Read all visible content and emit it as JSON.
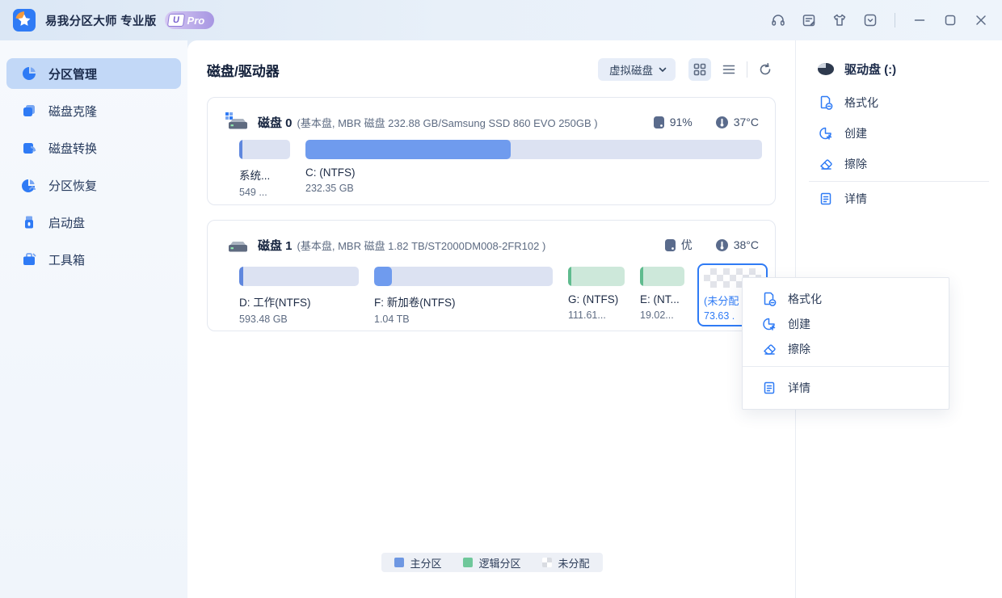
{
  "titlebar": {
    "app_title": "易我分区大师 专业版",
    "pro_u": "U",
    "pro_label": "Pro"
  },
  "sidebar": {
    "items": [
      {
        "label": "分区管理",
        "selected": true
      },
      {
        "label": "磁盘克隆",
        "selected": false
      },
      {
        "label": "磁盘转换",
        "selected": false
      },
      {
        "label": "分区恢复",
        "selected": false
      },
      {
        "label": "启动盘",
        "selected": false
      },
      {
        "label": "工具箱",
        "selected": false
      }
    ]
  },
  "main": {
    "title": "磁盘/驱动器",
    "disk_filter_value": "虚拟磁盘"
  },
  "disks": [
    {
      "name": "磁盘 0",
      "info": "(基本盘, MBR 磁盘 232.88 GB/Samsung SSD 860 EVO 250GB )",
      "health": "91%",
      "temperature": "37°C",
      "partitions": [
        {
          "label": "系统...",
          "size": "549 ...",
          "type": "primary"
        },
        {
          "label": "C: (NTFS)",
          "size": "232.35 GB",
          "type": "primary"
        }
      ]
    },
    {
      "name": "磁盘 1",
      "info": "(基本盘, MBR 磁盘 1.82 TB/ST2000DM008-2FR102 )",
      "health": "优",
      "temperature": "38°C",
      "partitions": [
        {
          "label": "D: 工作(NTFS)",
          "size": "593.48 GB",
          "type": "primary"
        },
        {
          "label": "F: 新加卷(NTFS)",
          "size": "1.04 TB",
          "type": "primary"
        },
        {
          "label": "G: (NTFS)",
          "size": "111.61...",
          "type": "logical"
        },
        {
          "label": "E: (NT...",
          "size": "19.02...",
          "type": "logical"
        },
        {
          "label": "(未分配",
          "size": "73.63 .",
          "type": "unallocated",
          "selected": true
        }
      ]
    }
  ],
  "right_panel": {
    "header": "驱动盘  (:)",
    "actions": [
      {
        "label": "格式化"
      },
      {
        "label": "创建"
      },
      {
        "label": "擦除"
      },
      {
        "label": "详情"
      }
    ]
  },
  "context_menu": {
    "items": [
      {
        "label": "格式化"
      },
      {
        "label": "创建"
      },
      {
        "label": "擦除"
      },
      {
        "label": "详情"
      }
    ]
  },
  "legend": {
    "primary": "主分区",
    "logical": "逻辑分区",
    "unallocated": "未分配"
  },
  "colors": {
    "accent": "#2f7bf5",
    "primary_partition": "#6e97e2",
    "logical_partition": "#6fc79a",
    "partition_track_blue": "#dce2f2",
    "partition_track_green": "#cde8da",
    "sidebar_selected_bg": "#c2d8f7",
    "pro_badge": "#a796e2"
  }
}
